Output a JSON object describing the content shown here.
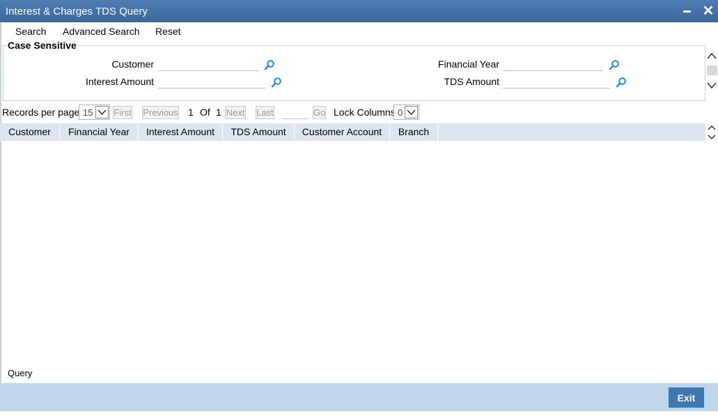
{
  "window": {
    "title": "Interest & Charges TDS Query",
    "minimize_icon": "minimize-icon",
    "close_icon": "close-icon",
    "close_glyph": "✕"
  },
  "menu": {
    "search": "Search",
    "advanced_search": "Advanced Search",
    "reset": "Reset"
  },
  "criteria": {
    "legend": "Case Sensitive",
    "customer_label": "Customer",
    "customer_value": "",
    "interest_amount_label": "Interest Amount",
    "interest_amount_value": "",
    "financial_year_label": "Financial Year",
    "financial_year_value": "",
    "tds_amount_label": "TDS Amount",
    "tds_amount_value": "",
    "lookup_icon": "search-icon"
  },
  "pager": {
    "records_per_page_label": "Records per page",
    "records_per_page_value": "15",
    "first": "First",
    "previous": "Previous",
    "current_page": "1",
    "of_label": "Of",
    "total_pages": "1",
    "next": "Next",
    "last": "Last",
    "go": "Go",
    "lock_columns_label": "Lock Columns",
    "lock_columns_value": "0"
  },
  "grid": {
    "columns": [
      "Customer",
      "Financial Year",
      "Interest Amount",
      "TDS Amount",
      "Customer Account",
      "Branch"
    ],
    "rows": []
  },
  "footer": {
    "query_label": "Query",
    "exit": "Exit"
  },
  "colors": {
    "titlebar": "#3a679f",
    "header_bg": "#dde6ee",
    "footer_bg": "#bed6ea",
    "accent": "#3f78b1",
    "lookup_icon": "#1a8fd1"
  }
}
